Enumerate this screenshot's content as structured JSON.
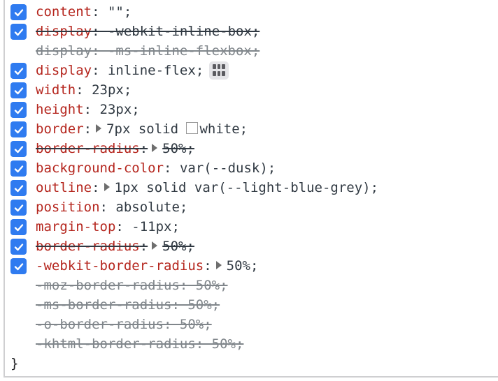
{
  "rules": [
    {
      "checked": true,
      "struck": false,
      "inactive": false,
      "prop": "content",
      "value": "\"\";"
    },
    {
      "checked": true,
      "struck": true,
      "inactive": false,
      "prop": "display",
      "value": "-webkit-inline-box;"
    },
    {
      "checked": false,
      "struck": false,
      "inactive": true,
      "prop": "display",
      "value": "-ms-inline-flexbox;"
    },
    {
      "checked": true,
      "struck": false,
      "inactive": false,
      "prop": "display",
      "value": "inline-flex;",
      "flex_editor_icon": "flexbox-editor-icon"
    },
    {
      "checked": true,
      "struck": false,
      "inactive": false,
      "prop": "width",
      "value": "23px;"
    },
    {
      "checked": true,
      "struck": false,
      "inactive": false,
      "prop": "height",
      "value": "23px;"
    },
    {
      "checked": true,
      "struck": false,
      "inactive": false,
      "prop": "border",
      "expandable": true,
      "value_pre": "7px solid ",
      "swatch_color": "#ffffff",
      "value": "white;"
    },
    {
      "checked": true,
      "struck": true,
      "inactive": false,
      "prop": "border-radius",
      "expandable": true,
      "value": "50%;"
    },
    {
      "checked": true,
      "struck": false,
      "inactive": false,
      "prop": "background-color",
      "value": "var(--dusk);"
    },
    {
      "checked": true,
      "struck": false,
      "inactive": false,
      "prop": "outline",
      "expandable": true,
      "value": "1px solid var(--light-blue-grey);"
    },
    {
      "checked": true,
      "struck": false,
      "inactive": false,
      "prop": "position",
      "value": "absolute;"
    },
    {
      "checked": true,
      "struck": false,
      "inactive": false,
      "prop": "margin-top",
      "value": "-11px;"
    },
    {
      "checked": true,
      "struck": true,
      "inactive": false,
      "prop": "border-radius",
      "expandable": true,
      "value": "50%;"
    },
    {
      "checked": true,
      "struck": false,
      "inactive": false,
      "prop": "-webkit-border-radius",
      "expandable": true,
      "value": "50%;"
    },
    {
      "checked": false,
      "struck": false,
      "inactive": true,
      "prop": "-moz-border-radius",
      "value": "50%;"
    },
    {
      "checked": false,
      "struck": false,
      "inactive": true,
      "prop": "-ms-border-radius",
      "value": "50%;"
    },
    {
      "checked": false,
      "struck": false,
      "inactive": true,
      "prop": "-o-border-radius",
      "value": "50%;"
    },
    {
      "checked": false,
      "struck": false,
      "inactive": true,
      "prop": "-khtml-border-radius",
      "value": "50%;"
    }
  ],
  "closing_brace": "}",
  "colors": {
    "checkbox": "#2f7bf0",
    "property": "#b5261e",
    "value": "#303942",
    "inactive": "#80868b"
  }
}
